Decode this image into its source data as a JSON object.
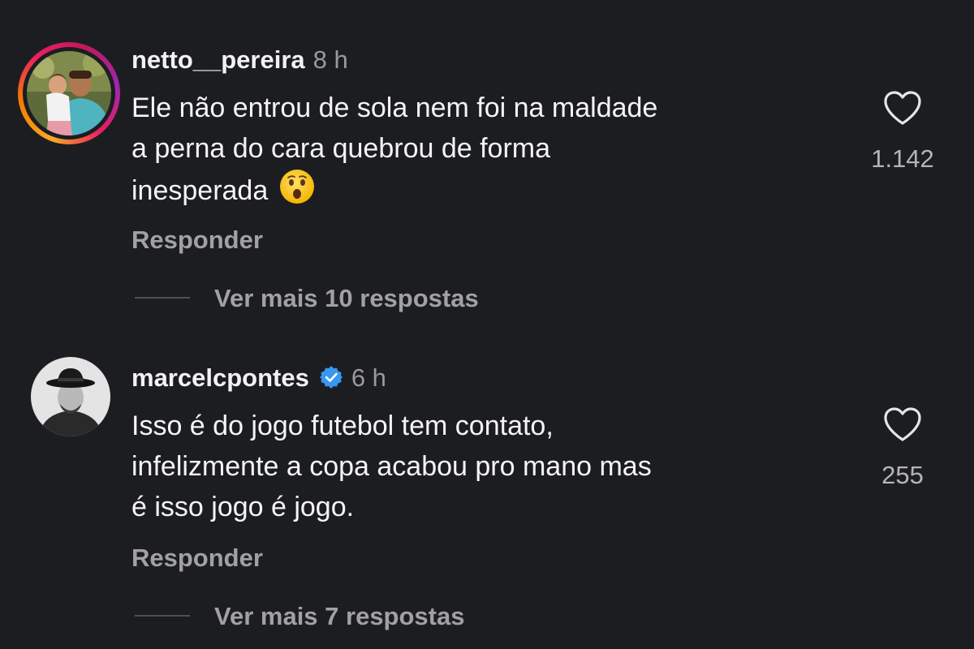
{
  "comments": [
    {
      "username": "netto__pereira",
      "time": "8 h",
      "verified": false,
      "lines": [
        "Ele não entrou de sola nem foi na maldade",
        "a perna do cara quebrou de forma",
        "inesperada"
      ],
      "emoji_icon": "astonished-face-icon",
      "reply_label": "Responder",
      "more_replies_label": "Ver mais 10 respostas",
      "likes": "1.142"
    },
    {
      "username": "marcelcpontes",
      "time": "6 h",
      "verified": true,
      "lines": [
        "Isso é do jogo futebol tem contato,",
        "infelizmente a copa acabou pro mano mas",
        "é isso jogo é jogo."
      ],
      "reply_label": "Responder",
      "more_replies_label": "Ver mais 7 respostas",
      "likes": "255"
    }
  ],
  "colors": {
    "background": "#1c1d21",
    "text": "#f4f4f4",
    "muted": "#a1a1a5",
    "verified_blue": "#3897f0"
  }
}
